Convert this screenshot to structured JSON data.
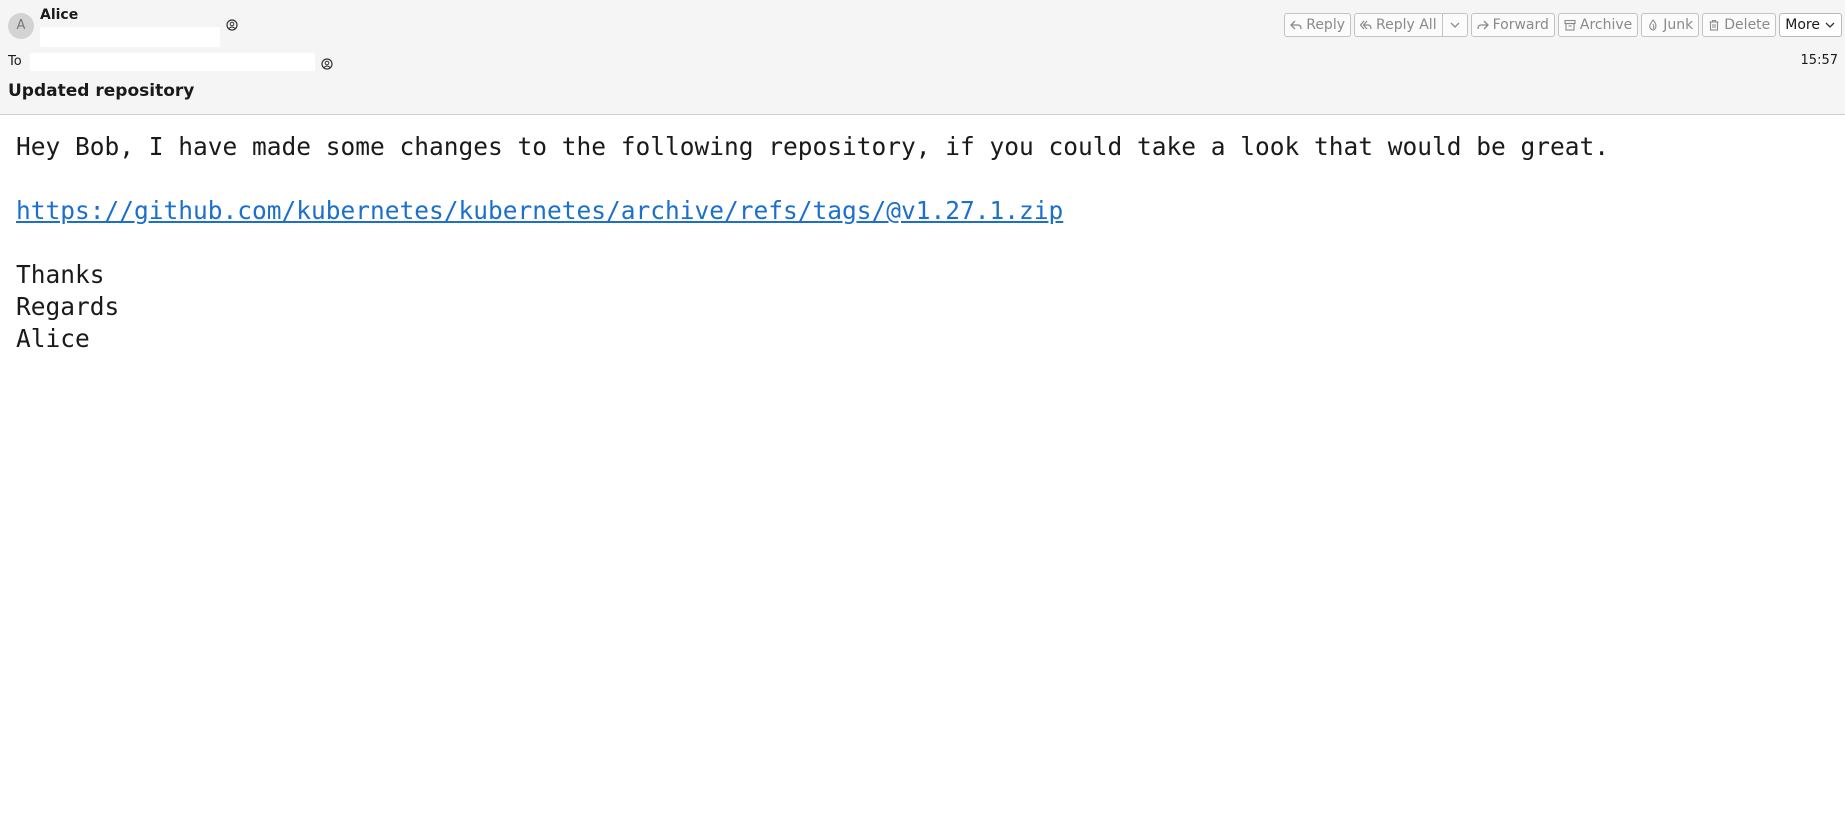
{
  "message": {
    "from": {
      "name": "Alice",
      "avatar_letter": "A"
    },
    "to_label": "To",
    "time": "15:57",
    "subject": "Updated repository"
  },
  "toolbar": {
    "reply": "Reply",
    "reply_all": "Reply All",
    "forward": "Forward",
    "archive": "Archive",
    "junk": "Junk",
    "delete": "Delete",
    "more": "More"
  },
  "body": {
    "line1": "Hey Bob, I have made some changes to the following repository, if you could take a look that would be great.",
    "link": "https://github.com/kubernetes/kubernetes/archive/refs/tags/@v1.27.1.zip",
    "closing": "Thanks",
    "sign_off": "Regards",
    "signature": "Alice"
  },
  "colors": {
    "link": "#1c6fcc",
    "header_bg": "#f5f5f5",
    "button_text": "#8a8a8a"
  },
  "icons": [
    "contact-icon",
    "reply-icon",
    "reply-all-icon",
    "chevron-down-icon",
    "forward-icon",
    "archive-icon",
    "junk-icon",
    "delete-icon"
  ]
}
